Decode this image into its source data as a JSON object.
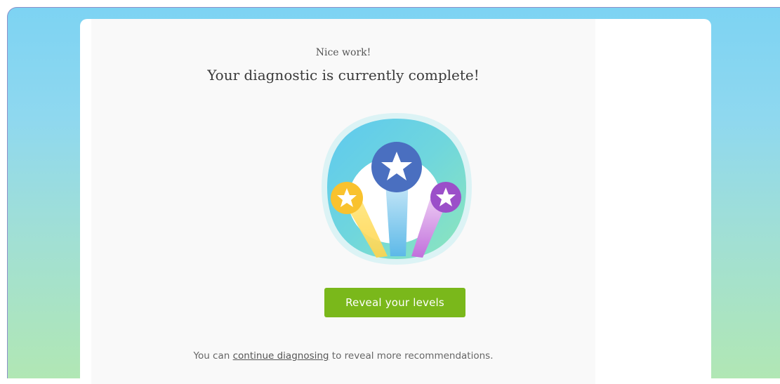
{
  "completion": {
    "eyebrow": "Nice work!",
    "headline": "Your diagnostic is currently complete!",
    "cta_label": "Reveal your levels",
    "footer": {
      "prefix": "You can ",
      "link": "continue diagnosing",
      "suffix": " to reveal more recommendations."
    }
  },
  "illustration": {
    "icon": "star-badges-icon",
    "stars": [
      {
        "name": "yellow-star",
        "color": "#f9c22e"
      },
      {
        "name": "blue-star",
        "color": "#4a6fc0"
      },
      {
        "name": "purple-star",
        "color": "#9b4fc9"
      }
    ]
  },
  "colors": {
    "cta": "#7ab81b",
    "background_top": "#7dd3f3",
    "background_bottom": "#b1e7b4"
  }
}
